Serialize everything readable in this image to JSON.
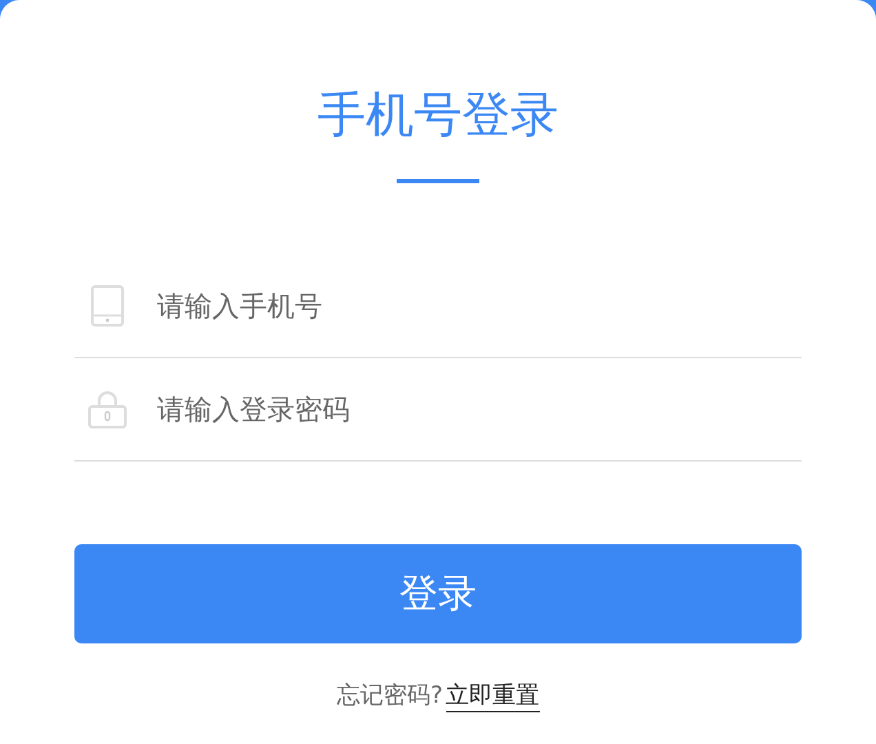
{
  "title": "手机号登录",
  "fields": [
    {
      "kind": "phone",
      "placeholder": "请输入手机号"
    },
    {
      "kind": "lock",
      "placeholder": "请输入登录密码"
    }
  ],
  "submit": "登录",
  "forgot": {
    "text": "忘记密码?",
    "link": "立即重置"
  }
}
